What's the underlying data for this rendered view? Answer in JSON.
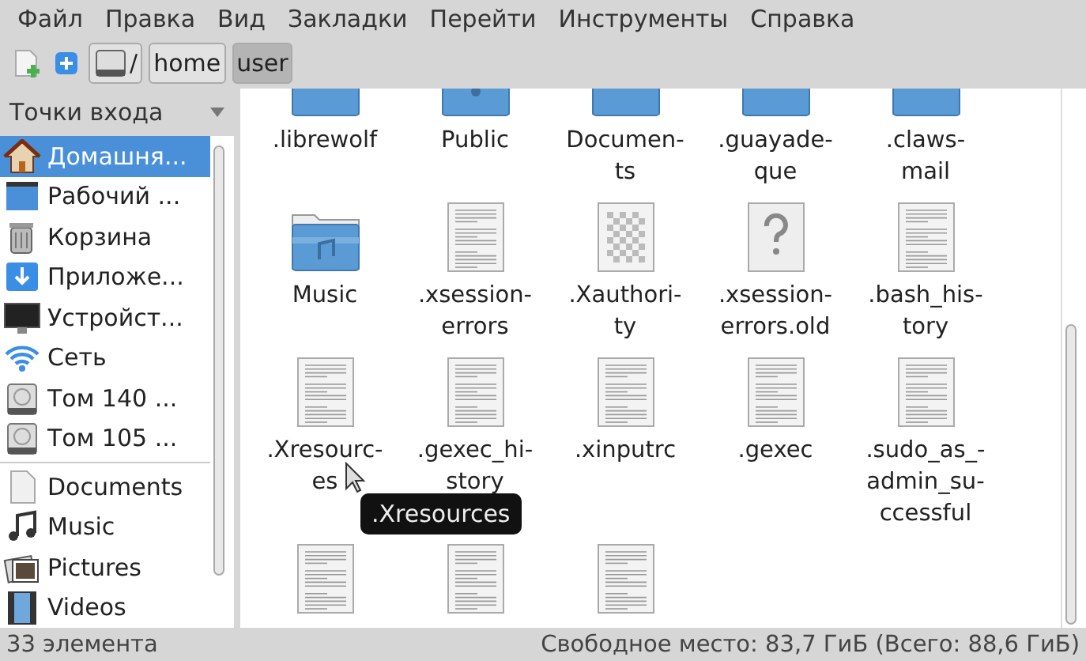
{
  "menu": [
    "Файл",
    "Правка",
    "Вид",
    "Закладки",
    "Перейти",
    "Инструменты",
    "Справка"
  ],
  "toolbar": {
    "path": [
      {
        "label": "/",
        "kind": "root",
        "selected": false
      },
      {
        "label": "home",
        "kind": "dir",
        "selected": false
      },
      {
        "label": "user",
        "kind": "dir",
        "selected": true
      }
    ]
  },
  "sidebar": {
    "title": "Точки входа",
    "places": [
      {
        "label": "Домашня...",
        "kind": "home",
        "selected": true
      },
      {
        "label": "Рабочий ...",
        "kind": "desktop",
        "selected": false
      },
      {
        "label": "Корзина",
        "kind": "trash",
        "selected": false
      },
      {
        "label": "Приложе...",
        "kind": "download",
        "selected": false
      },
      {
        "label": "Устройст...",
        "kind": "monitor",
        "selected": false
      },
      {
        "label": "Сеть",
        "kind": "wifi",
        "selected": false
      },
      {
        "label": "Том 140 ...",
        "kind": "drive",
        "selected": false
      },
      {
        "label": "Том 105 ...",
        "kind": "drive",
        "selected": false
      }
    ],
    "bookmarks": [
      {
        "label": "Documents",
        "kind": "document",
        "selected": false
      },
      {
        "label": "Music",
        "kind": "music",
        "selected": false
      },
      {
        "label": "Pictures",
        "kind": "pictures",
        "selected": false
      },
      {
        "label": "Videos",
        "kind": "video",
        "selected": false
      }
    ]
  },
  "files": [
    {
      "lines": [
        ".librewolf"
      ],
      "kind": "folder"
    },
    {
      "lines": [
        "Public"
      ],
      "kind": "folder-share"
    },
    {
      "lines": [
        "Documen-",
        "ts"
      ],
      "kind": "folder"
    },
    {
      "lines": [
        ".guayade-",
        "que"
      ],
      "kind": "folder"
    },
    {
      "lines": [
        ".claws-",
        "mail"
      ],
      "kind": "folder"
    },
    {
      "lines": [
        "Music"
      ],
      "kind": "folder-music"
    },
    {
      "lines": [
        ".xsession-",
        "errors"
      ],
      "kind": "text"
    },
    {
      "lines": [
        ".Xauthori-",
        "ty"
      ],
      "kind": "image"
    },
    {
      "lines": [
        ".xsession-",
        "errors.old"
      ],
      "kind": "unknown"
    },
    {
      "lines": [
        ".bash_his-",
        "tory"
      ],
      "kind": "text"
    },
    {
      "lines": [
        ".Xresourc-",
        "es"
      ],
      "kind": "text"
    },
    {
      "lines": [
        ".gexec_hi-",
        "story"
      ],
      "kind": "text"
    },
    {
      "lines": [
        ".xinputrc"
      ],
      "kind": "text"
    },
    {
      "lines": [
        ".gexec"
      ],
      "kind": "text"
    },
    {
      "lines": [
        ".sudo_as_-",
        "admin_su-",
        "ccessful"
      ],
      "kind": "text"
    },
    {
      "kind": "text"
    },
    {
      "kind": "text"
    },
    {
      "kind": "text"
    }
  ],
  "tooltip": ".Xresources",
  "status_bar": {
    "count": "33 элемента",
    "free_space": "Свободное место: 83,7 ГиБ (Всего: 88,6 ГиБ)"
  }
}
